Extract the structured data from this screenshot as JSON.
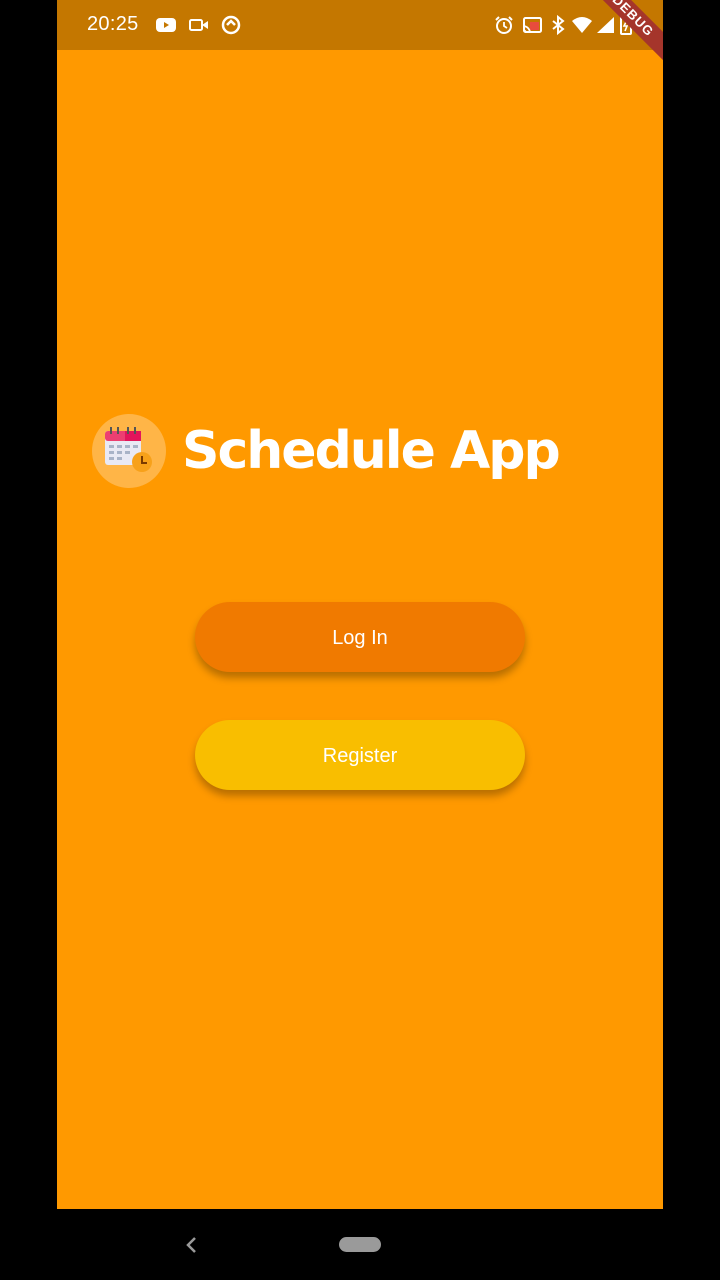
{
  "status_bar": {
    "time": "20:25",
    "left_icons": [
      "youtube-icon",
      "video-camera-icon",
      "sync-icon"
    ],
    "right_icons": [
      "alarm-icon",
      "cast-icon",
      "bluetooth-icon",
      "wifi-icon",
      "signal-icon",
      "battery-icon"
    ]
  },
  "debug_banner": "DEBUG",
  "app": {
    "title": "Schedule App",
    "logo": "calendar-icon"
  },
  "buttons": {
    "login_label": "Log In",
    "register_label": "Register"
  },
  "colors": {
    "background": "#FF9900",
    "status_bar": "#C47700",
    "login_button": "#F07A00",
    "register_button": "#F9BE00"
  },
  "navigation": {
    "back": "back-icon",
    "home": "home-pill"
  }
}
